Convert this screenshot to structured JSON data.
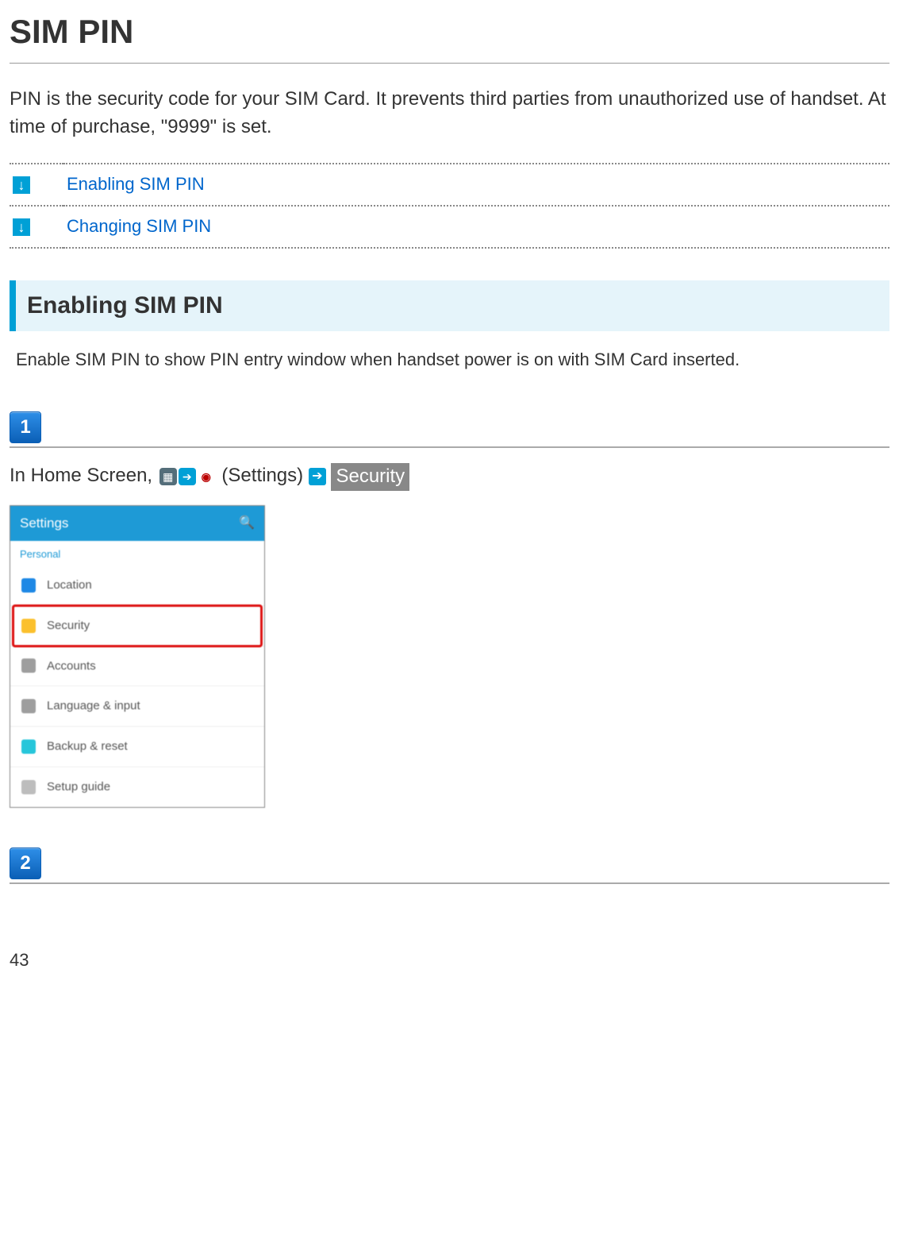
{
  "title": "SIM PIN",
  "intro": "PIN is the security code for your SIM Card. It prevents third parties from unauthorized use of handset. At time of purchase, \"9999\" is set.",
  "toc": [
    {
      "label": "Enabling SIM PIN"
    },
    {
      "label": "Changing SIM PIN"
    }
  ],
  "section": {
    "heading": "Enabling SIM PIN",
    "desc": "Enable SIM PIN to show PIN entry window when handset power is on with SIM Card inserted."
  },
  "steps": [
    {
      "num": "1",
      "prefix": "In Home Screen, ",
      "after_icons": " (Settings)",
      "chip": "Security",
      "screenshot": {
        "header": "Settings",
        "section": "Personal",
        "rows": [
          {
            "label": "Location",
            "bullet": "b1",
            "selected": false
          },
          {
            "label": "Security",
            "bullet": "b2",
            "selected": true
          },
          {
            "label": "Accounts",
            "bullet": "b3",
            "selected": false
          },
          {
            "label": "Language & input",
            "bullet": "b4",
            "selected": false
          },
          {
            "label": "Backup & reset",
            "bullet": "b5",
            "selected": false
          },
          {
            "label": "Setup guide",
            "bullet": "b6",
            "selected": false
          }
        ]
      }
    },
    {
      "num": "2"
    }
  ],
  "page_number": "43"
}
